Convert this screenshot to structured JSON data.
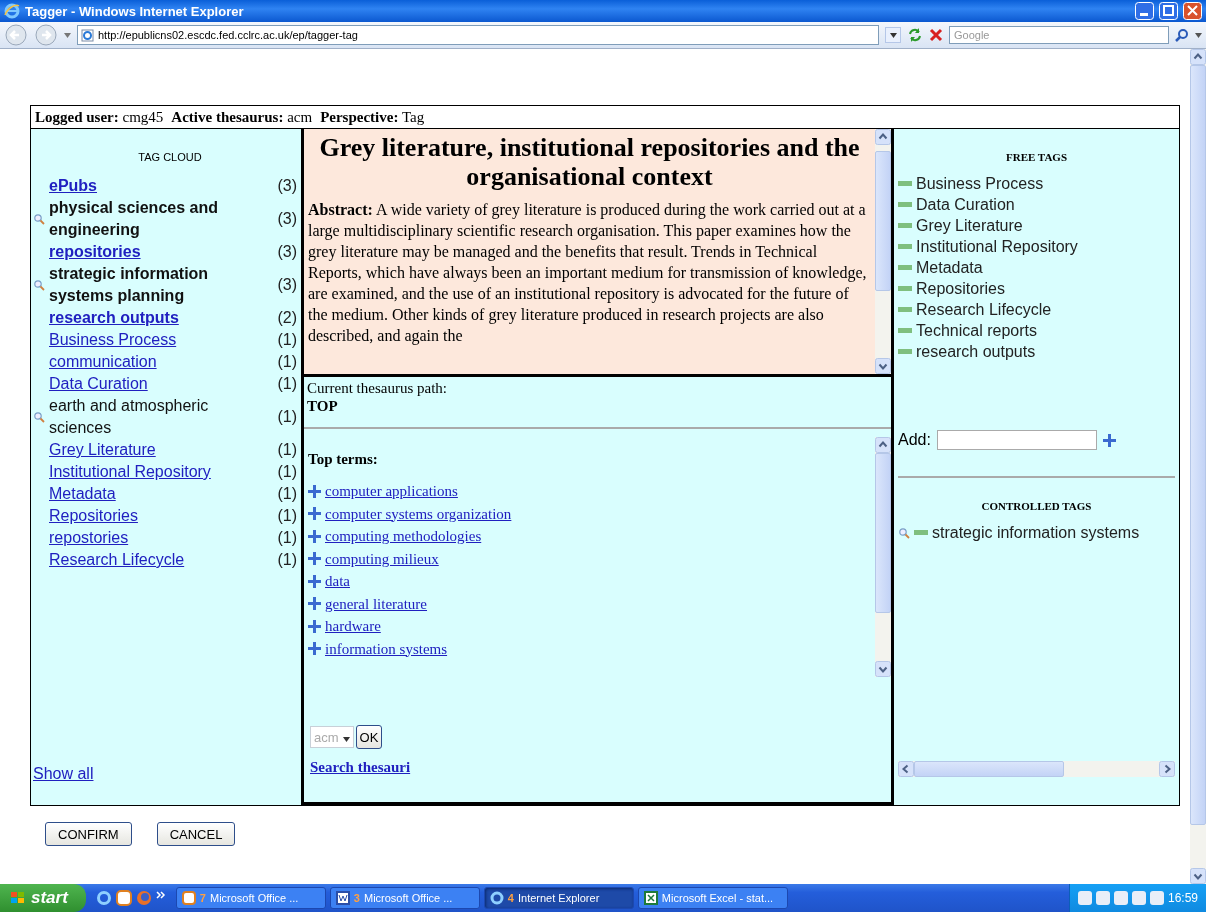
{
  "window": {
    "title": "Tagger - Windows Internet Explorer"
  },
  "address_bar": {
    "url": "http://epublicns02.escdc.fed.cclrc.ac.uk/ep/tagger-tag",
    "search_placeholder": "Google"
  },
  "info_bar": [
    {
      "label": "Logged user:",
      "value": "cmg45"
    },
    {
      "label": "Active thesaurus:",
      "value": "acm"
    },
    {
      "label": "Perspective:",
      "value": "Tag"
    }
  ],
  "tag_cloud": {
    "title": "TAG CLOUD",
    "items": [
      {
        "label": "ePubs",
        "count": "(3)",
        "kind": "link",
        "bold": true
      },
      {
        "label": "physical sciences and engineering",
        "count": "(3)",
        "kind": "concept",
        "bold": true
      },
      {
        "label": "repositories",
        "count": "(3)",
        "kind": "link",
        "bold": true
      },
      {
        "label": "strategic information systems planning",
        "count": "(3)",
        "kind": "concept",
        "bold": true
      },
      {
        "label": "research outputs",
        "count": "(2)",
        "kind": "link",
        "bold": true
      },
      {
        "label": "Business Process",
        "count": "(1)",
        "kind": "link",
        "bold": false
      },
      {
        "label": "communication",
        "count": "(1)",
        "kind": "link",
        "bold": false
      },
      {
        "label": "Data Curation",
        "count": "(1)",
        "kind": "link",
        "bold": false
      },
      {
        "label": "earth and atmospheric sciences",
        "count": "(1)",
        "kind": "concept",
        "bold": false
      },
      {
        "label": "Grey Literature",
        "count": "(1)",
        "kind": "link",
        "bold": false
      },
      {
        "label": "Institutional Repository",
        "count": "(1)",
        "kind": "link",
        "bold": false
      },
      {
        "label": "Metadata",
        "count": "(1)",
        "kind": "link",
        "bold": false
      },
      {
        "label": "Repositories",
        "count": "(1)",
        "kind": "link",
        "bold": false
      },
      {
        "label": "repostories",
        "count": "(1)",
        "kind": "link",
        "bold": false
      },
      {
        "label": "Research Lifecycle",
        "count": "(1)",
        "kind": "link",
        "bold": false
      }
    ],
    "show_all": "Show all"
  },
  "document": {
    "title": "Grey literature, institutional repositories and the organisational context",
    "abstract": "**Abstract:** A wide variety of grey literature is produced during the work carried out at a large multidisciplinary scientific research organisation. This paper examines how the grey literature may be managed and the benefits that result. Trends in Technical Reports, which have always been an important medium for transmission of knowledge, are examined, and the use of an institutional repository is advocated for the future of the medium. Other kinds of grey literature produced in research projects are also described, and again the"
  },
  "thesaurus": {
    "path_label": "Current thesaurus path:",
    "path": "TOP",
    "top_terms_label": "Top terms:",
    "terms": [
      "computer applications",
      "computer systems organization",
      "computing methodologies",
      "computing milieux",
      "data",
      "general literature",
      "hardware",
      "information systems"
    ],
    "select": {
      "value": "acm",
      "disabled": true
    },
    "ok_button": "OK",
    "search_link": "Search thesauri"
  },
  "free_tags": {
    "title": "FREE TAGS",
    "items": [
      "Business Process",
      "Data Curation",
      "Grey Literature",
      "Institutional Repository",
      "Metadata",
      "Repositories",
      "Research Lifecycle",
      "Technical reports",
      "research outputs"
    ],
    "add_label": "Add:"
  },
  "controlled_tags": {
    "title": "CONTROLLED TAGS",
    "items": [
      "strategic information systems"
    ]
  },
  "buttons": [
    "CONFIRM",
    "CANCEL"
  ],
  "taskbar": {
    "start": "start",
    "items": [
      {
        "count": "7",
        "label": "Microsoft Office ...",
        "kind": "office",
        "selected": false
      },
      {
        "count": "3",
        "label": "Microsoft Office ...",
        "kind": "word",
        "selected": false
      },
      {
        "count": "4",
        "label": "Internet Explorer",
        "kind": "browser",
        "selected": true
      },
      {
        "label": "Microsoft Excel - stat...",
        "kind": "excel",
        "selected": false
      }
    ],
    "clock": "16:59"
  }
}
